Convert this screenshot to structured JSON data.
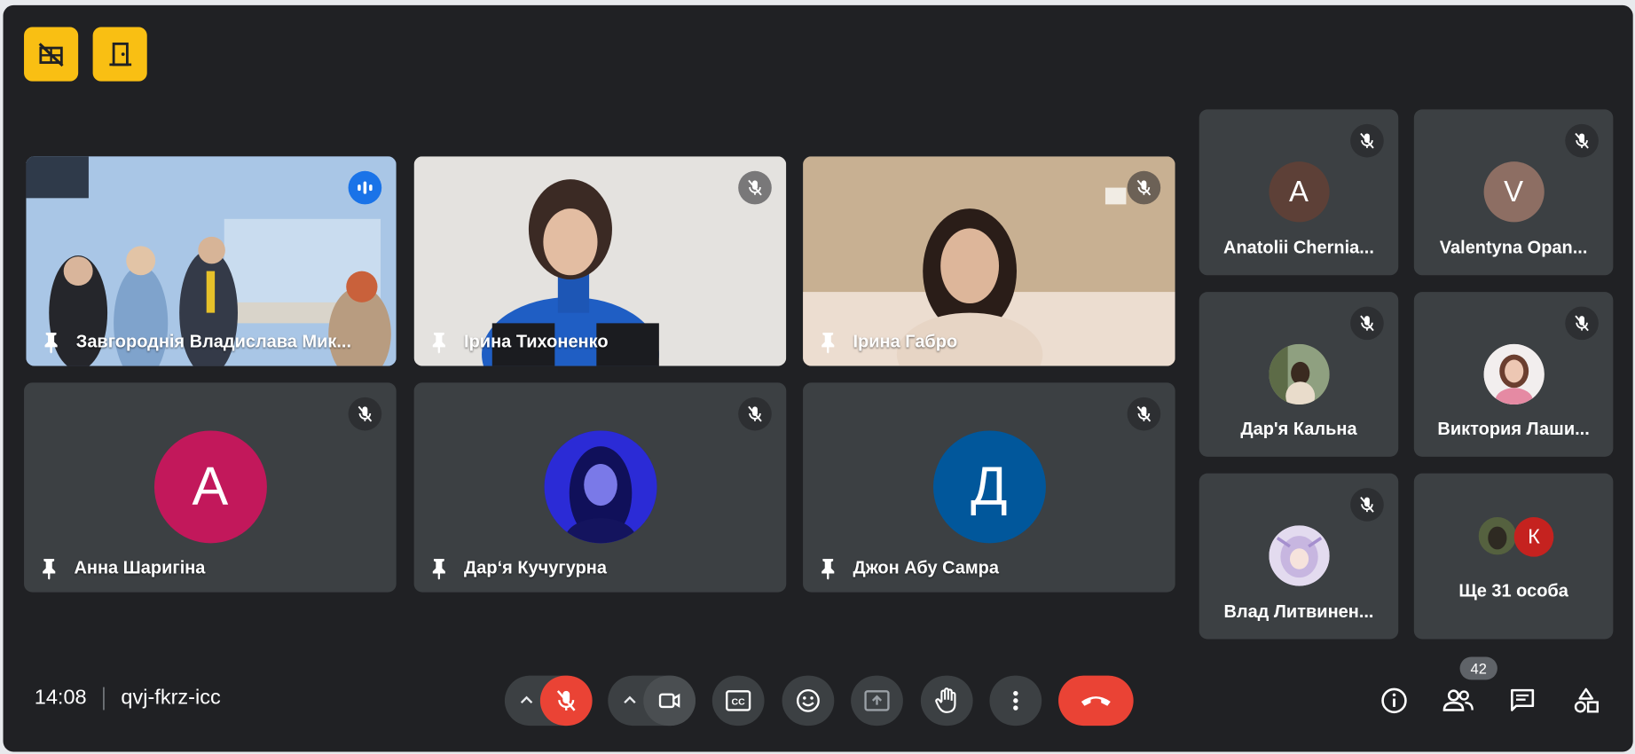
{
  "header_buttons": [
    {
      "icon": "no-video-grid-icon"
    },
    {
      "icon": "door-exit-icon"
    }
  ],
  "main_tiles": [
    {
      "name": "Завгороднія Владислава Мик...",
      "type": "video",
      "speaking": true,
      "muted": false
    },
    {
      "name": "Ірина Тихоненко",
      "type": "video",
      "speaking": false,
      "muted": true
    },
    {
      "name": "Ірина Габро",
      "type": "video",
      "speaking": false,
      "muted": true
    },
    {
      "name": "Анна Шаригіна",
      "type": "avatar",
      "initial": "А",
      "avatar_color": "#c2185b",
      "muted": true
    },
    {
      "name": "Дар‘я Кучугурна",
      "type": "photo-avatar",
      "muted": true
    },
    {
      "name": "Джон Абу Самра",
      "type": "avatar",
      "initial": "Д",
      "avatar_color": "#01579b",
      "muted": true
    }
  ],
  "side_tiles": [
    {
      "name": "Anatolii Chernia...",
      "initial": "A",
      "avatar_color": "#5d4037",
      "muted": true
    },
    {
      "name": "Valentyna Opan...",
      "initial": "V",
      "avatar_color": "#8d6e63",
      "muted": true
    },
    {
      "name": "Дар'я Кальна",
      "type": "photo",
      "muted": true
    },
    {
      "name": "Виктория Лаши...",
      "type": "photo",
      "muted": true
    },
    {
      "name": "Влад Литвинен...",
      "type": "photo",
      "muted": true
    }
  ],
  "more_tile": {
    "label": "Ще 31 особа",
    "initial": "К",
    "avatar_color": "#c5221f"
  },
  "footer": {
    "time": "14:08",
    "meeting_code": "qvj-fkrz-icc",
    "participants_count": "42"
  },
  "colors": {
    "background": "#202124",
    "tile": "#3c4043",
    "accent_red": "#ea4335",
    "accent_yellow": "#f9bf13"
  }
}
